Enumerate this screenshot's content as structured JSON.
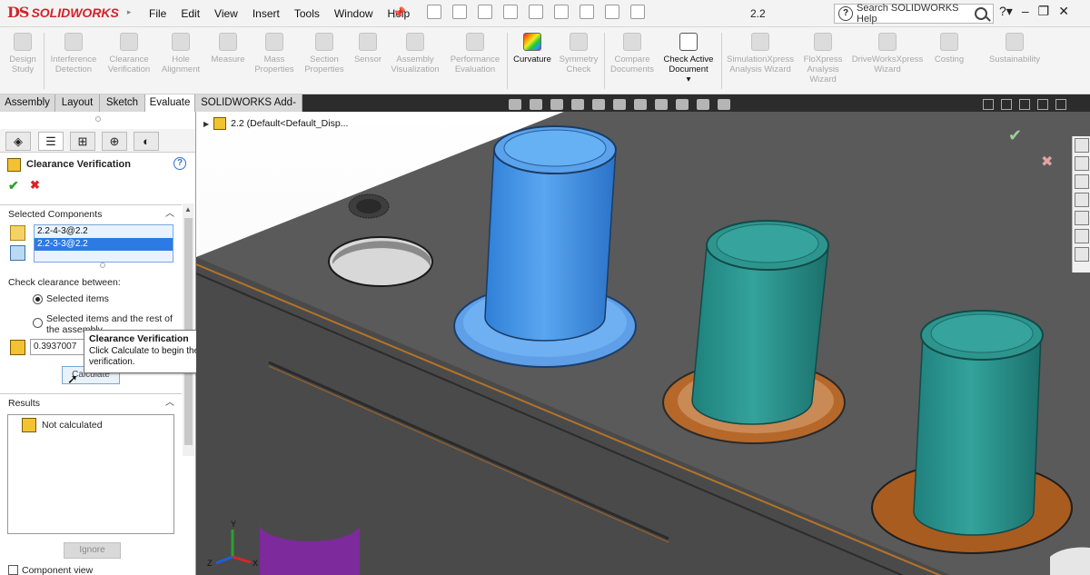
{
  "app": {
    "brand": "SOLIDWORKS",
    "brand_mark": "DS",
    "menus": [
      "File",
      "Edit",
      "View",
      "Insert",
      "Tools",
      "Window",
      "Help"
    ],
    "document_title": "2.2",
    "search_placeholder": "Search SOLIDWORKS Help"
  },
  "ribbon": {
    "items": [
      {
        "label1": "Design",
        "label2": "Study",
        "enabled": false
      },
      {
        "label1": "Interference",
        "label2": "Detection",
        "enabled": false
      },
      {
        "label1": "Clearance",
        "label2": "Verification",
        "enabled": false
      },
      {
        "label1": "Hole",
        "label2": "Alignment",
        "enabled": false
      },
      {
        "label1": "Measure",
        "label2": "",
        "enabled": false
      },
      {
        "label1": "Mass",
        "label2": "Properties",
        "enabled": false
      },
      {
        "label1": "Section",
        "label2": "Properties",
        "enabled": false
      },
      {
        "label1": "Sensor",
        "label2": "",
        "enabled": false
      },
      {
        "label1": "Assembly",
        "label2": "Visualization",
        "enabled": false
      },
      {
        "label1": "Performance",
        "label2": "Evaluation",
        "enabled": false
      },
      {
        "label1": "Curvature",
        "label2": "",
        "enabled": true
      },
      {
        "label1": "Symmetry",
        "label2": "Check",
        "enabled": false
      },
      {
        "label1": "Compare",
        "label2": "Documents",
        "enabled": false
      },
      {
        "label1": "Check Active",
        "label2": "Document",
        "enabled": true
      },
      {
        "label1": "SimulationXpress",
        "label2": "Analysis Wizard",
        "enabled": false
      },
      {
        "label1": "FloXpress",
        "label2": "Analysis",
        "label3": "Wizard",
        "enabled": false
      },
      {
        "label1": "DriveWorksXpress",
        "label2": "Wizard",
        "enabled": false
      },
      {
        "label1": "Costing",
        "label2": "",
        "enabled": false
      },
      {
        "label1": "Sustainability",
        "label2": "",
        "enabled": false
      }
    ]
  },
  "tabs": [
    "Assembly",
    "Layout",
    "Sketch",
    "Evaluate",
    "SOLIDWORKS Add-Ins"
  ],
  "active_tab": "Evaluate",
  "property_manager": {
    "title": "Clearance Verification",
    "selected_components_header": "Selected Components",
    "components": [
      "2.2-4-3@2.2",
      "2.2-3-3@2.2"
    ],
    "check_between_label": "Check clearance between:",
    "option_selected": "Selected items",
    "option_rest_line1": "Selected items and the rest of",
    "option_rest_line2": "the assembly",
    "min_clearance": "0.3937007",
    "calculate_label": "Calculate",
    "results_header": "Results",
    "result_text": "Not calculated",
    "ignore_label": "Ignore",
    "component_view_label": "Component view"
  },
  "tooltip": {
    "title": "Clearance Verification",
    "body": "Click Calculate to begin the clearance verification."
  },
  "viewport": {
    "tree_item": "2.2  (Default<Default_Disp...",
    "axes": {
      "x": "X",
      "y": "Y",
      "z": "Z"
    }
  }
}
